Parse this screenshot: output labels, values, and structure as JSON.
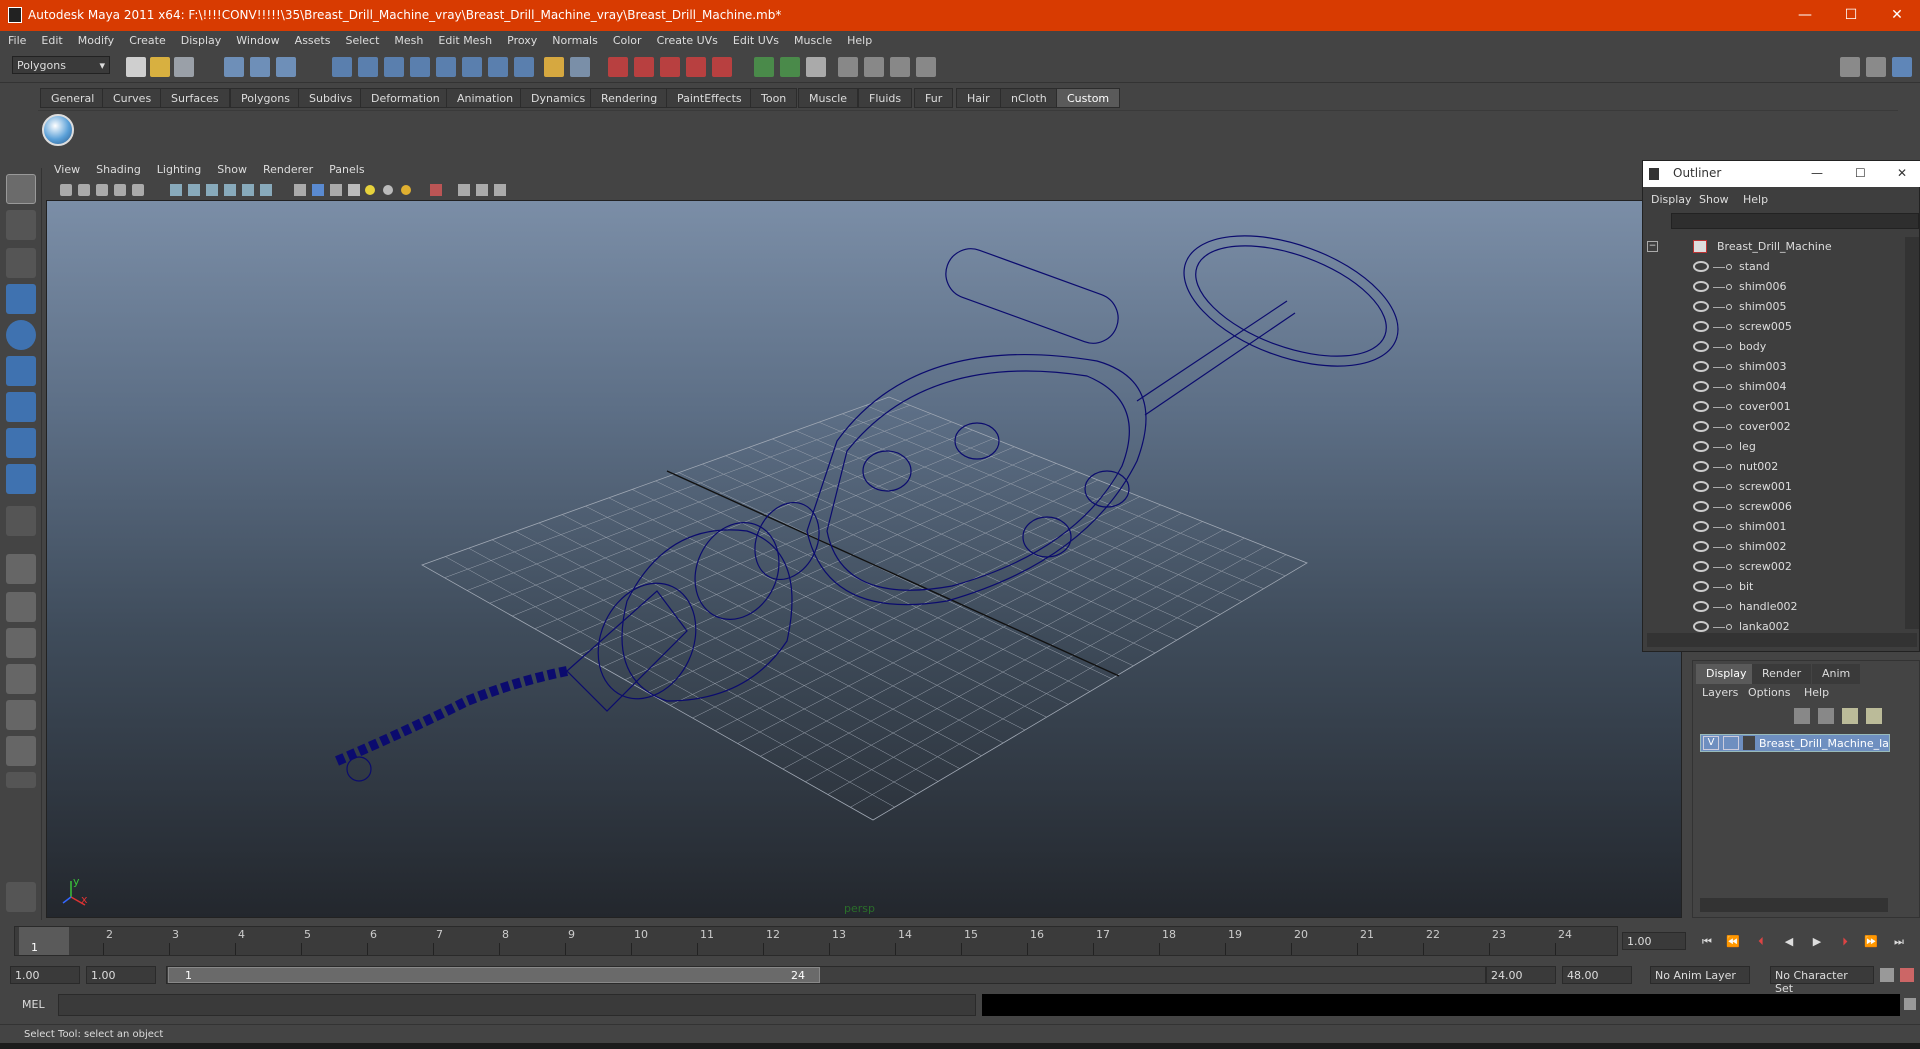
{
  "window": {
    "title": "Autodesk Maya 2011 x64: F:\\!!!!CONV!!!!!\\35\\Breast_Drill_Machine_vray\\Breast_Drill_Machine_vray\\Breast_Drill_Machine.mb*",
    "minimize": "—",
    "maximize": "☐",
    "close": "✕"
  },
  "menu": [
    "File",
    "Edit",
    "Modify",
    "Create",
    "Display",
    "Window",
    "Assets",
    "Select",
    "Mesh",
    "Edit Mesh",
    "Proxy",
    "Normals",
    "Color",
    "Create UVs",
    "Edit UVs",
    "Muscle",
    "Help"
  ],
  "mode_selector": "Polygons",
  "shelf_tabs": [
    "General",
    "Curves",
    "Surfaces",
    "Polygons",
    "Subdivs",
    "Deformation",
    "Animation",
    "Dynamics",
    "Rendering",
    "PaintEffects",
    "Toon",
    "Muscle",
    "Fluids",
    "Fur",
    "Hair",
    "nCloth",
    "Custom"
  ],
  "active_shelf_tab": "Custom",
  "panel_menu": [
    "View",
    "Shading",
    "Lighting",
    "Show",
    "Renderer",
    "Panels"
  ],
  "viewport": {
    "camera_label": "persp",
    "axis_y": "y",
    "axis_x": "x",
    "model_color": "#0b0b6e"
  },
  "outliner": {
    "title": "Outliner",
    "menu": [
      "Display",
      "Show",
      "Help"
    ],
    "root": "Breast_Drill_Machine",
    "items": [
      "stand",
      "shim006",
      "shim005",
      "screw005",
      "body",
      "shim003",
      "shim004",
      "cover001",
      "cover002",
      "leg",
      "nut002",
      "screw001",
      "screw006",
      "shim001",
      "shim002",
      "screw002",
      "bit",
      "handle002",
      "lanka002"
    ]
  },
  "layer_editor": {
    "tabs": [
      "Display",
      "Render",
      "Anim"
    ],
    "active_tab": "Display",
    "menu": [
      "Layers",
      "Options",
      "Help"
    ],
    "layer_visible": "V",
    "layer_name": "Breast_Drill_Machine_layer"
  },
  "timeline": {
    "ticks": [
      "1",
      "2",
      "3",
      "4",
      "5",
      "6",
      "7",
      "8",
      "9",
      "10",
      "11",
      "12",
      "13",
      "14",
      "15",
      "16",
      "17",
      "18",
      "19",
      "20",
      "21",
      "22",
      "23",
      "24"
    ],
    "current_frame_marker": "1",
    "current_time": "1.00"
  },
  "range": {
    "start": "1.00",
    "playback_start": "1.00",
    "slider_start": "1",
    "slider_end": "24",
    "playback_end": "24.00",
    "end": "48.00",
    "anim_layer": "No Anim Layer",
    "character_set": "No Character Set"
  },
  "command_line": {
    "label": "MEL"
  },
  "help_line": "Select Tool: select an object"
}
